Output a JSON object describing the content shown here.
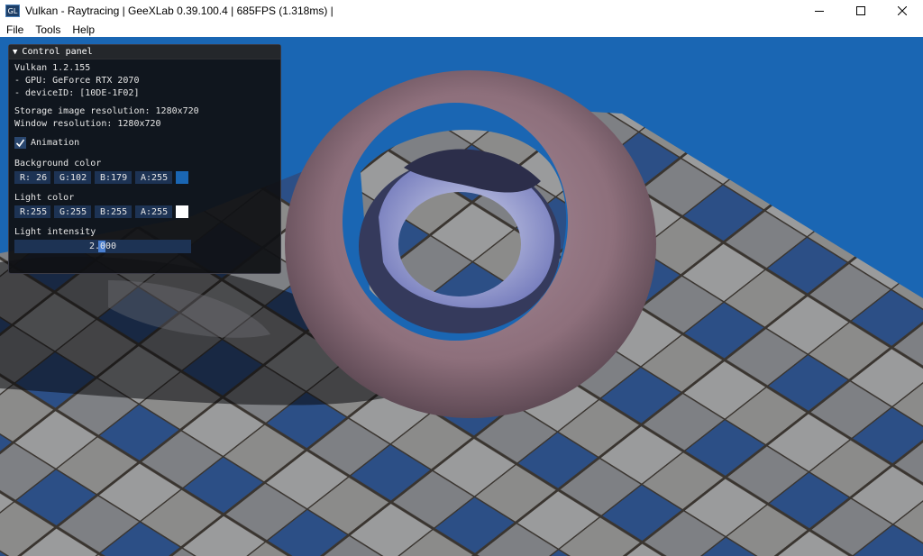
{
  "window": {
    "icon_text": "GL",
    "title": "Vulkan - Raytracing | GeeXLab 0.39.100.4 | 685FPS (1.318ms) |"
  },
  "menu": {
    "items": [
      "File",
      "Tools",
      "Help"
    ]
  },
  "panel": {
    "title": "Control panel",
    "info": {
      "vulkan": "Vulkan 1.2.155",
      "gpu": "- GPU: GeForce RTX 2070",
      "device": "- deviceID: [10DE-1F02]",
      "storage_res": "Storage image resolution: 1280x720",
      "window_res": "Window resolution: 1280x720"
    },
    "animation": {
      "label": "Animation",
      "checked": true
    },
    "background_color": {
      "label": "Background color",
      "r": "R: 26",
      "g": "G:102",
      "b": "B:179",
      "a": "A:255",
      "hex": "#1a66b3"
    },
    "light_color": {
      "label": "Light color",
      "r": "R:255",
      "g": "G:255",
      "b": "B:255",
      "a": "A:255",
      "hex": "#ffffff"
    },
    "light_intensity": {
      "label": "Light intensity",
      "value": "2.000"
    }
  },
  "colors": {
    "accent": "#29466e",
    "field_bg": "#1d3354",
    "panel_bg": "#101114"
  }
}
